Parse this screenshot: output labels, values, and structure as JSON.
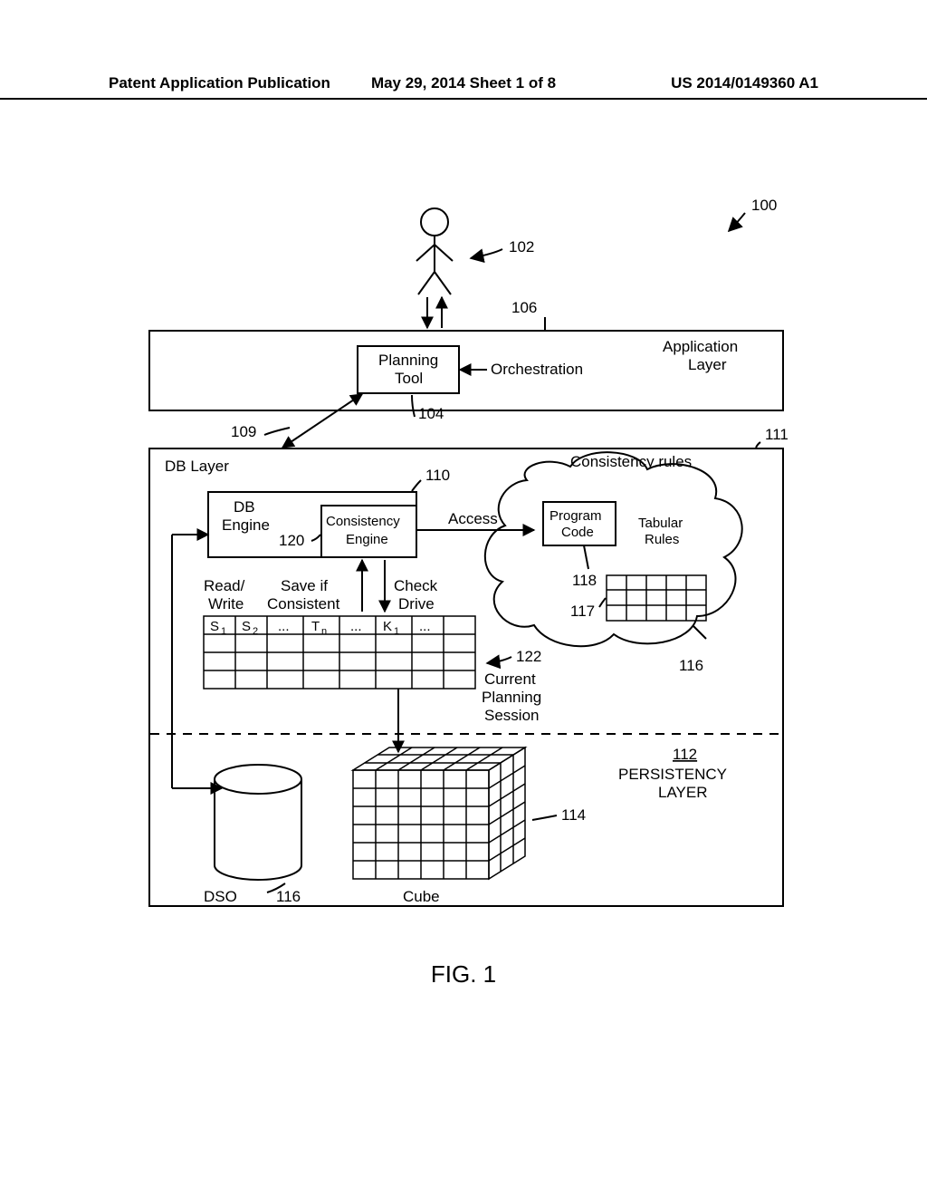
{
  "header": {
    "left": "Patent Application Publication",
    "center": "May 29, 2014  Sheet 1 of 8",
    "right": "US 2014/0149360 A1"
  },
  "figure_caption": "FIG. 1",
  "refs": {
    "r100": "100",
    "r102": "102",
    "r104": "104",
    "r106": "106",
    "r109": "109",
    "r110": "110",
    "r111": "111",
    "r112": "112",
    "r114": "114",
    "r116a": "116",
    "r116b": "116",
    "r117": "117",
    "r118": "118",
    "r120": "120",
    "r122": "122"
  },
  "labels": {
    "application_layer": "Application Layer",
    "planning_tool": "Planning Tool",
    "orchestration": "Orchestration",
    "db_layer": "DB Layer",
    "db_engine": "DB Engine",
    "consistency_engine": "Consistency Engine",
    "consistency_rules": "Consistency rules",
    "access": "Access",
    "program_code": "Program Code",
    "tabular_rules": "Tabular Rules",
    "read_write": "Read/ Write",
    "save_if_consistent": "Save if Consistent",
    "check_drive": "Check Drive",
    "current_planning_session": "Current Planning Session",
    "persistency_layer": "PERSISTENCY LAYER",
    "dso": "DSO",
    "cube": "Cube",
    "s1_a": "S",
    "s1_b": "1",
    "s2_a": "S",
    "s2_b": "2",
    "dots1": "...",
    "tn_a": "T",
    "tn_b": "n",
    "dots2": "...",
    "k1_a": "K",
    "k1_b": "1",
    "dots3": "..."
  }
}
